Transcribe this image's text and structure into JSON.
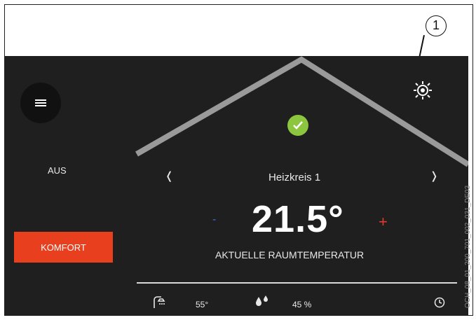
{
  "callout": {
    "number": "1"
  },
  "mode": {
    "status": "AUS",
    "button_label": "KOMFORT"
  },
  "zone": {
    "name": "Heizkreis 1",
    "prev": "❬",
    "next": "❭"
  },
  "temperature": {
    "value": "21.5°",
    "label": "AKTUELLE RAUMTEMPERATUR",
    "minus": "-",
    "plus": "+"
  },
  "status": {
    "ok_icon": "check-icon",
    "ok_color": "#8cc63f"
  },
  "bottom_bar": {
    "water_temp": "55°",
    "humidity": "45 %"
  },
  "side_code": "OCH_08_01_200_701_002_031_DE03",
  "colors": {
    "accent": "#e8401f",
    "background": "#1f1f1f",
    "minus": "#3a6fd8",
    "plus": "#e33b2a"
  }
}
